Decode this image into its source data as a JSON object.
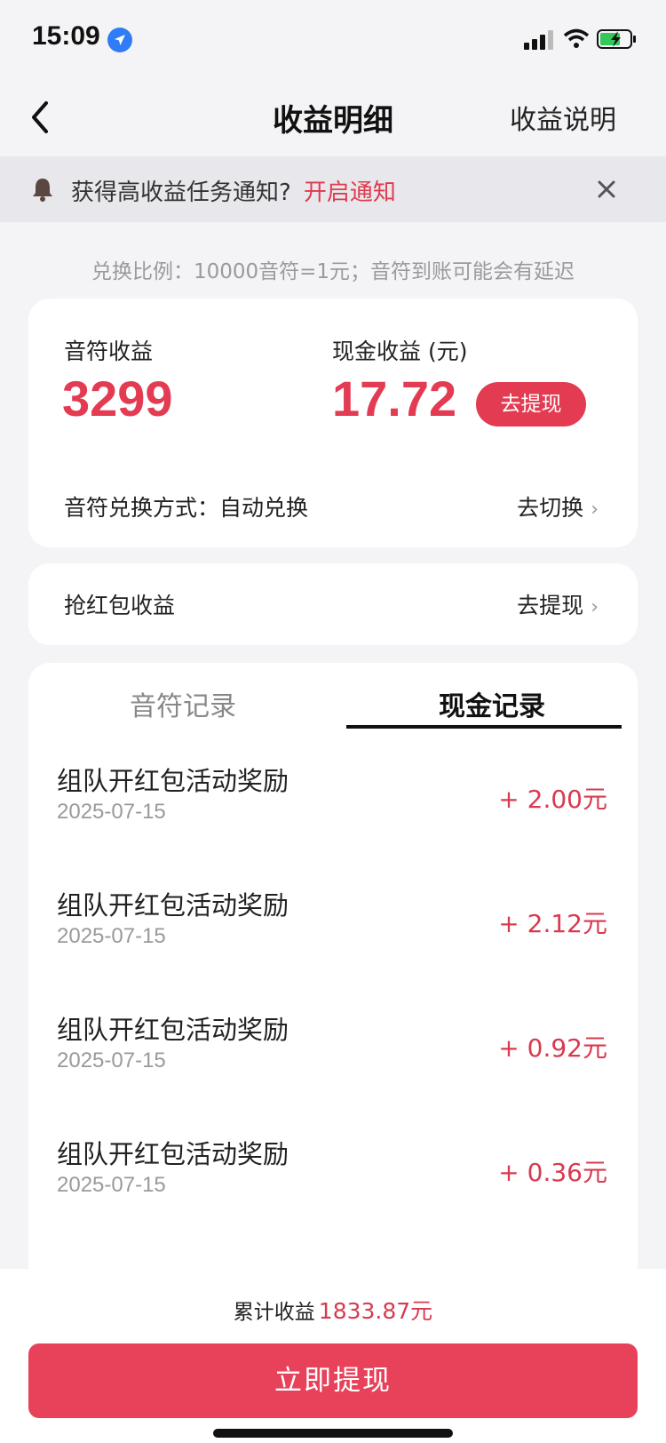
{
  "status_bar": {
    "time": "15:09"
  },
  "nav": {
    "title": "收益明细",
    "right_link": "收益说明"
  },
  "notice": {
    "text": "获得高收益任务通知?",
    "action": "开启通知"
  },
  "exchange_ratio": "兑换比例：10000音符=1元；音符到账可能会有延迟",
  "earnings": {
    "note_label": "音符收益",
    "note_value": "3299",
    "cash_label": "现金收益 (元)",
    "cash_value": "17.72",
    "withdraw_label": "去提现",
    "exchange_mode_label": "音符兑换方式：自动兑换",
    "switch_label": "去切换"
  },
  "red_packet": {
    "label": "抢红包收益",
    "link": "去提现"
  },
  "tabs": [
    {
      "label": "音符记录",
      "active": false
    },
    {
      "label": "现金记录",
      "active": true
    }
  ],
  "records": [
    {
      "title": "组队开红包活动奖励",
      "date": "2025-07-15",
      "amount": "+ 2.00元"
    },
    {
      "title": "组队开红包活动奖励",
      "date": "2025-07-15",
      "amount": "+ 2.12元"
    },
    {
      "title": "组队开红包活动奖励",
      "date": "2025-07-15",
      "amount": "+ 0.92元"
    },
    {
      "title": "组队开红包活动奖励",
      "date": "2025-07-15",
      "amount": "+ 0.36元"
    }
  ],
  "footer": {
    "total_label": "累计收益",
    "total_value": "1833.87元",
    "button_label": "立即提现"
  },
  "icons": {
    "location": "location-arrow-icon",
    "signal": "signal-icon",
    "wifi": "wifi-icon",
    "battery": "battery-charging-icon",
    "back": "back-chevron-icon",
    "bell": "bell-icon",
    "close": "close-icon",
    "chevron": "chevron-right-icon"
  },
  "colors": {
    "accent": "#e23b52",
    "button": "#e8415a",
    "background": "#f4f4f6",
    "notice_bg": "#e8e8ec"
  }
}
